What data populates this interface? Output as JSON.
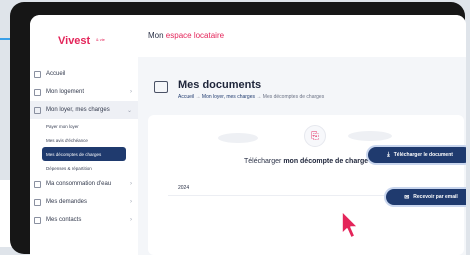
{
  "brand": {
    "name": "Vivest",
    "tagline": "& vie"
  },
  "header": {
    "title_prefix": "Mon",
    "title_accent": "espace locataire"
  },
  "sidebar": {
    "items": [
      {
        "label": "Accueil",
        "has_chevron": false
      },
      {
        "label": "Mon logement",
        "has_chevron": true
      },
      {
        "label": "Mon loyer, mes charges",
        "has_chevron": true,
        "expanded": true
      }
    ],
    "subitems": [
      {
        "label": "Payer mon loyer",
        "active": false
      },
      {
        "label": "Mes avis d'échéance",
        "active": false
      },
      {
        "label": "Mes décomptes de charges",
        "active": true
      },
      {
        "label": "Dépenses & répartition",
        "active": false
      }
    ],
    "items_after": [
      {
        "label": "Ma consommation d'eau",
        "has_chevron": true
      },
      {
        "label": "Mes demandes",
        "has_chevron": true
      },
      {
        "label": "Mes contacts",
        "has_chevron": true
      }
    ]
  },
  "page": {
    "title": "Mes documents",
    "breadcrumb": [
      "Accueil",
      "Mon loyer, mes charges",
      "Mes décomptes de charges"
    ],
    "breadcrumb_sep": "→"
  },
  "card": {
    "download_prefix": "Télécharger",
    "download_emphasis": "mon décompte de charge",
    "year": "2024"
  },
  "actions": {
    "email_label": "Recevoir par email",
    "download_label": "Télécharger le document"
  },
  "colors": {
    "brand_pink": "#e4255a",
    "navy": "#1f3a6e"
  },
  "icons": [
    "file-icon",
    "envelope-icon",
    "download-icon",
    "documents-icon",
    "cursor-icon"
  ]
}
